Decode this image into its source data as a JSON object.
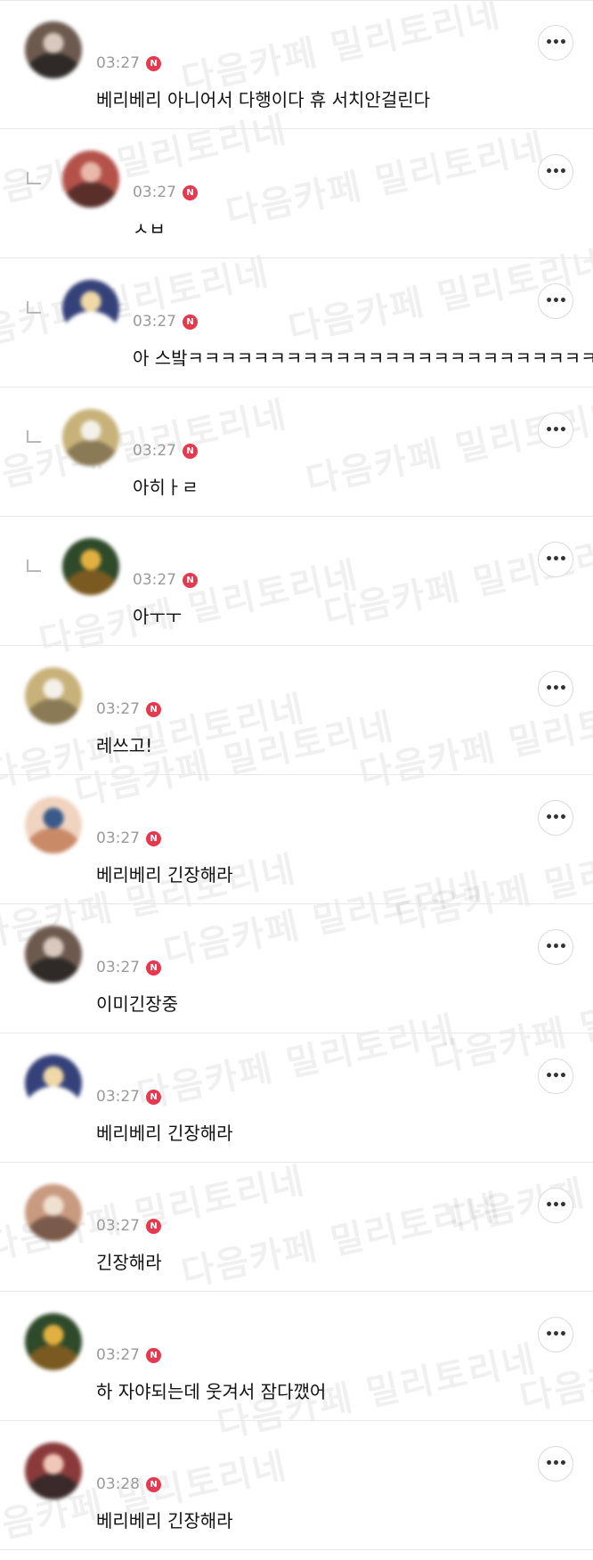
{
  "watermark_text": "다음카페 밀리토리네",
  "badge_label": "N",
  "more_icon": "more-horizontal-icon",
  "colors": {
    "badge": "#e53950",
    "time": "#9a9a9a",
    "divider": "#e8e8e8"
  },
  "comments": [
    {
      "reply": false,
      "time": "03:27",
      "text": "베리베리 아니어서 다행이다 휴 서치안걸린다",
      "avatar_colors": [
        "#6d5a4f",
        "#d8c8bd",
        "#2f2a28"
      ]
    },
    {
      "reply": true,
      "time": "03:27",
      "text": "ㅅㅂ",
      "avatar_colors": [
        "#b4524a",
        "#e8b8a8",
        "#5a2f2a"
      ]
    },
    {
      "reply": true,
      "time": "03:27",
      "text": "아 스밬ㅋㅋㅋㅋㅋㅋㅋㅋㅋㅋㅋㅋㅋㅋㅋㅋㅋㅋㅋㅋㅋㅋㅋㅋㅋ",
      "avatar_colors": [
        "#35427a",
        "#f0d9a6",
        "#ffffff"
      ]
    },
    {
      "reply": true,
      "time": "03:27",
      "text": "아히ㅏㄹ",
      "avatar_colors": [
        "#c8b27a",
        "#f4f1ea",
        "#8a7a55"
      ]
    },
    {
      "reply": true,
      "time": "03:27",
      "text": "아ㅜㅜ",
      "avatar_colors": [
        "#2e4a2a",
        "#e2b040",
        "#7a5a20"
      ]
    },
    {
      "reply": false,
      "time": "03:27",
      "text": "레쓰고!",
      "avatar_colors": [
        "#c8b27a",
        "#f4f1ea",
        "#8a7a55"
      ]
    },
    {
      "reply": false,
      "time": "03:27",
      "text": "베리베리 긴장해라",
      "avatar_colors": [
        "#f0d4c0",
        "#3a5a8a",
        "#c98a68"
      ]
    },
    {
      "reply": false,
      "time": "03:27",
      "text": "이미긴장중",
      "avatar_colors": [
        "#6d5a4f",
        "#d8c8bd",
        "#2f2a28"
      ]
    },
    {
      "reply": false,
      "time": "03:27",
      "text": "베리베리 긴장해라",
      "avatar_colors": [
        "#35427a",
        "#f0d9a6",
        "#ffffff"
      ]
    },
    {
      "reply": false,
      "time": "03:27",
      "text": "긴장해라",
      "avatar_colors": [
        "#c89a80",
        "#f0e0d0",
        "#7a5a4a"
      ]
    },
    {
      "reply": false,
      "time": "03:27",
      "text": "하 자야되는데 웃겨서 잠다깼어",
      "avatar_colors": [
        "#2e4a2a",
        "#e2b040",
        "#7a5a20"
      ]
    },
    {
      "reply": false,
      "time": "03:28",
      "text": "베리베리 긴장해라",
      "avatar_colors": [
        "#8a3a3a",
        "#f0c8b8",
        "#3a2a2a"
      ]
    }
  ]
}
